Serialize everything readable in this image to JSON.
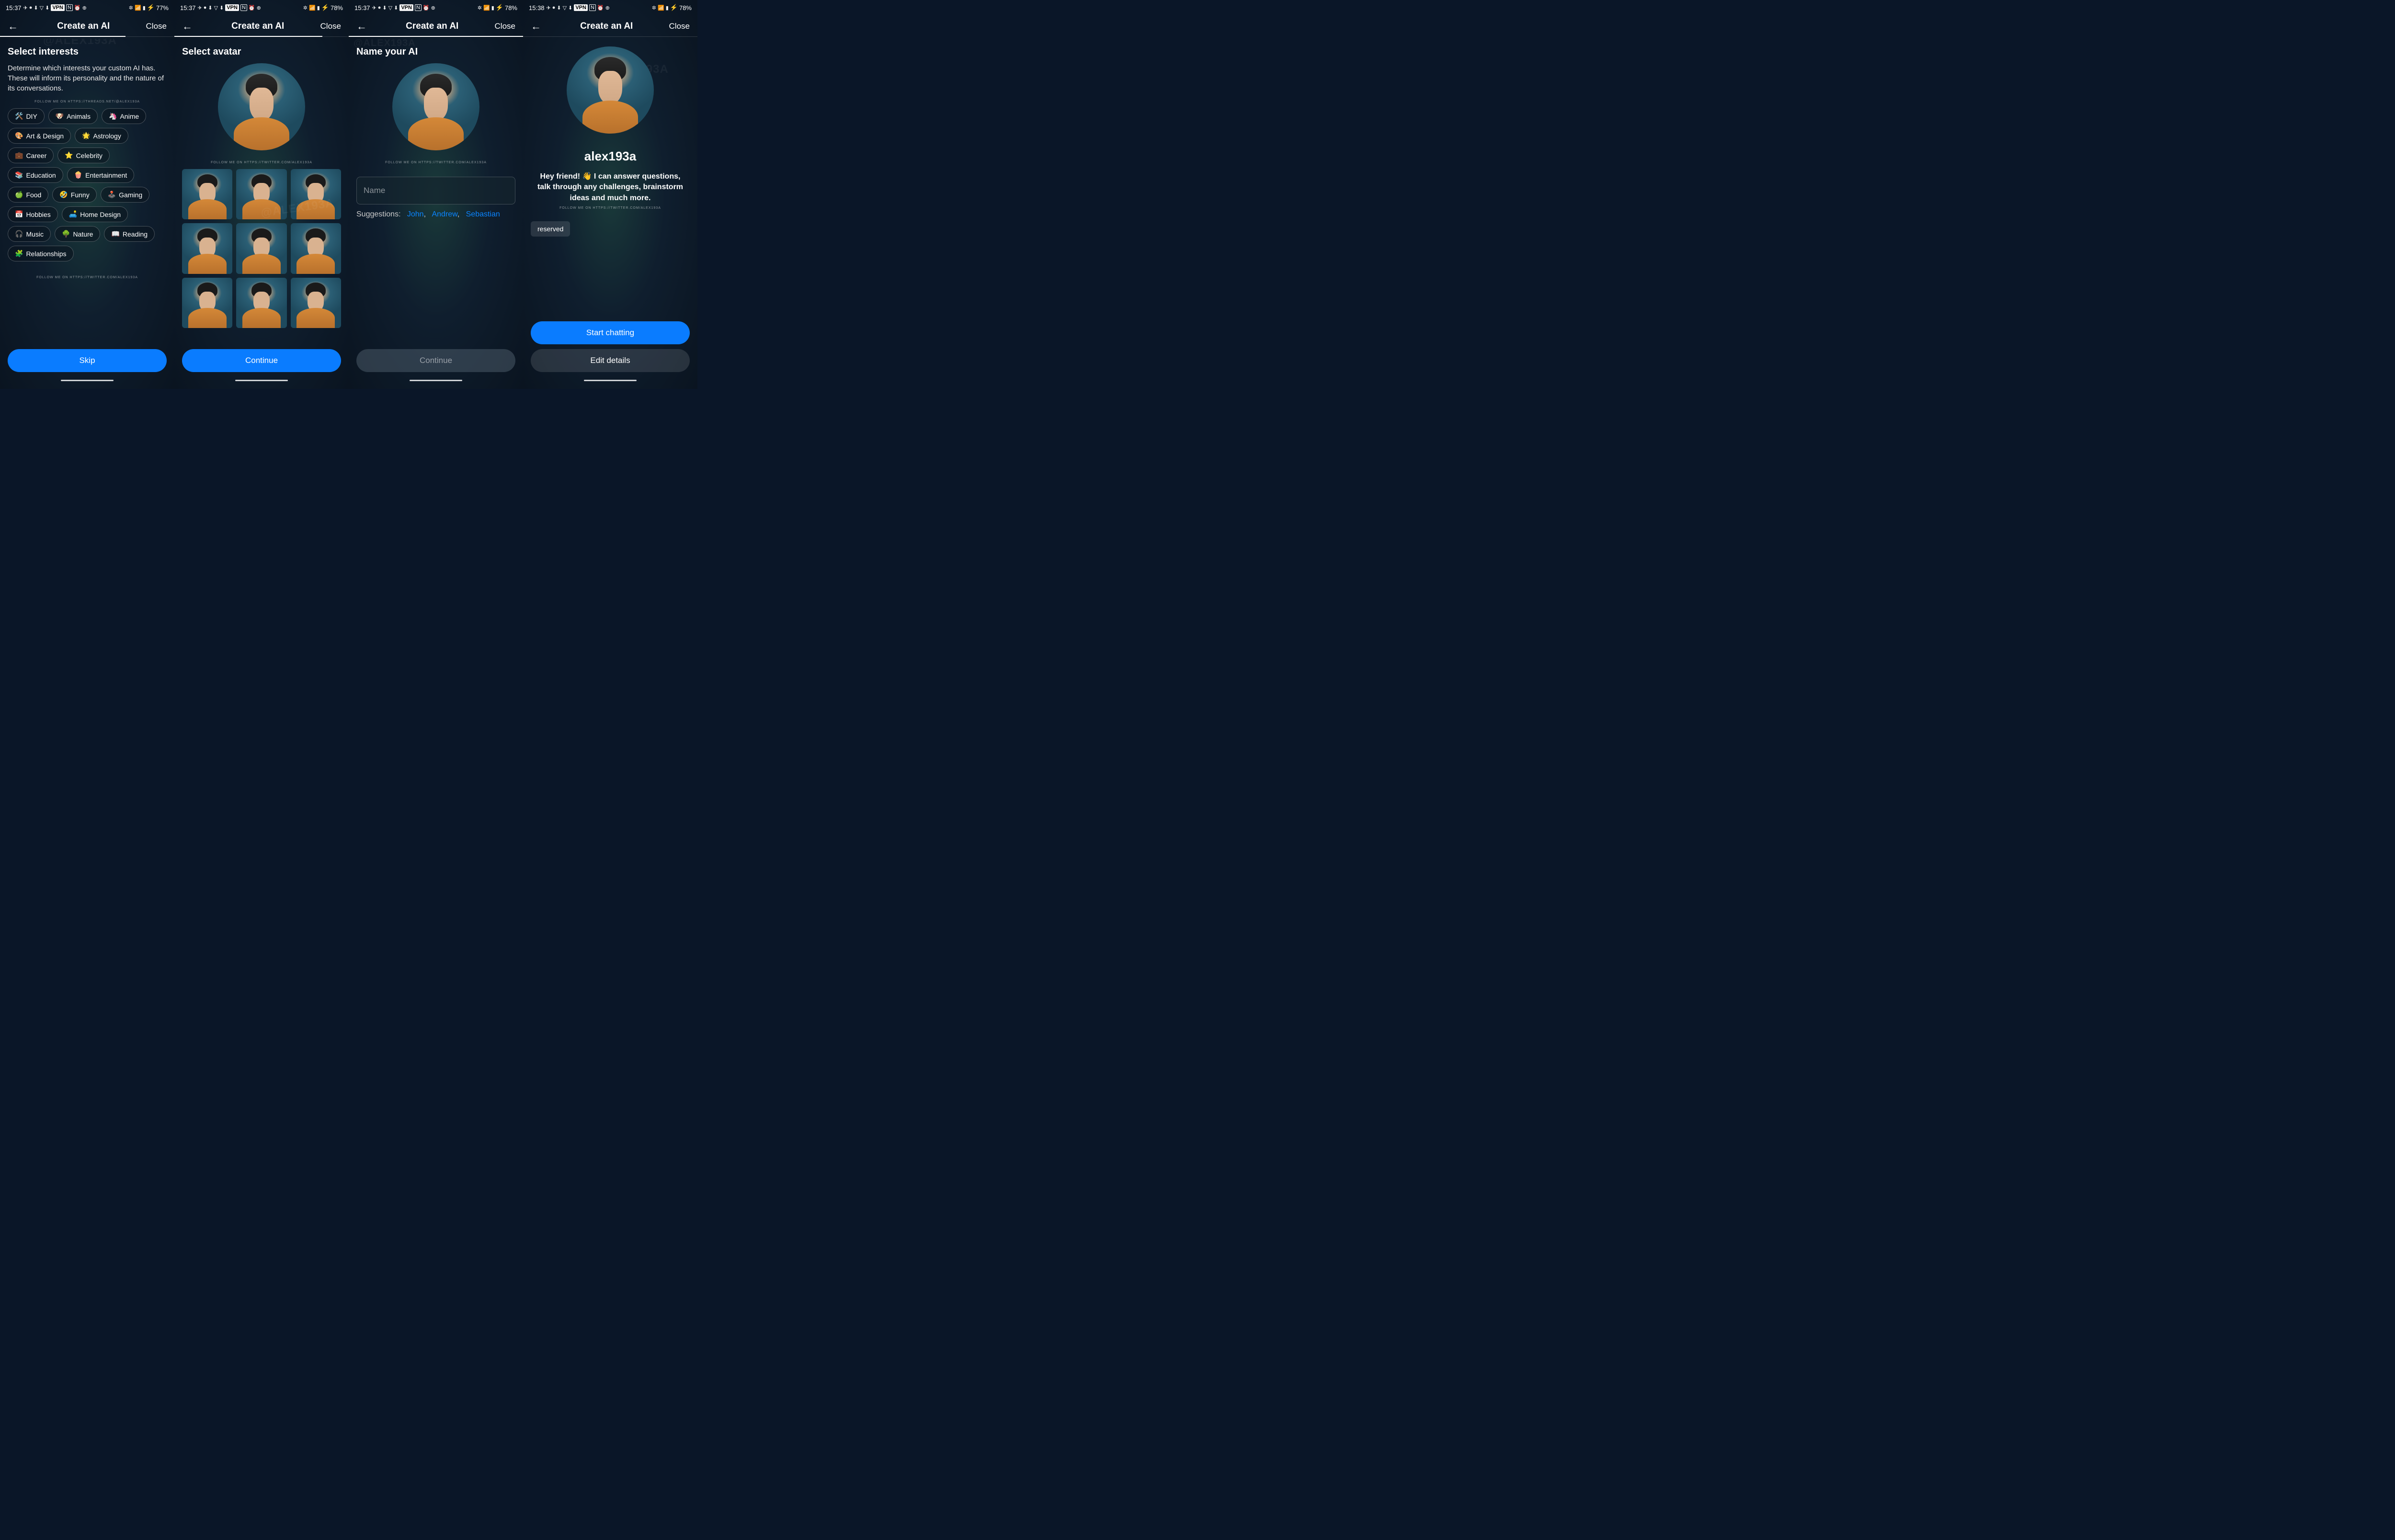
{
  "screens": [
    {
      "statusTime": "15:37",
      "battery": "77%",
      "header": {
        "title": "Create an AI",
        "close": "Close"
      },
      "sectionTitle": "Select interests",
      "sectionDesc": "Determine which interests your custom AI has. These will inform its personality and the nature of its conversations.",
      "followTop": "FOLLOW ME ON HTTPS://THREADS.NET/@ALEX193A",
      "followBottom": "FOLLOW ME ON HTTPS://TWITTER.COM/ALEX193A",
      "interests": [
        {
          "icon": "🛠️",
          "label": "DIY"
        },
        {
          "icon": "🐶",
          "label": "Animals"
        },
        {
          "icon": "🦄",
          "label": "Anime"
        },
        {
          "icon": "🎨",
          "label": "Art & Design"
        },
        {
          "icon": "🌟",
          "label": "Astrology"
        },
        {
          "icon": "💼",
          "label": "Career"
        },
        {
          "icon": "⭐",
          "label": "Celebrity"
        },
        {
          "icon": "📚",
          "label": "Education"
        },
        {
          "icon": "🍿",
          "label": "Entertainment"
        },
        {
          "icon": "🍏",
          "label": "Food"
        },
        {
          "icon": "🤣",
          "label": "Funny"
        },
        {
          "icon": "🕹️",
          "label": "Gaming"
        },
        {
          "icon": "📅",
          "label": "Hobbies"
        },
        {
          "icon": "🛋️",
          "label": "Home Design"
        },
        {
          "icon": "🎧",
          "label": "Music"
        },
        {
          "icon": "🌳",
          "label": "Nature"
        },
        {
          "icon": "📖",
          "label": "Reading"
        },
        {
          "icon": "🧩",
          "label": "Relationships"
        }
      ],
      "primaryBtn": "Skip"
    },
    {
      "statusTime": "15:37",
      "battery": "78%",
      "header": {
        "title": "Create an AI",
        "close": "Close"
      },
      "sectionTitle": "Select avatar",
      "followMid": "FOLLOW ME ON HTTPS://TWITTER.COM/ALEX193A",
      "avatarCount": 9,
      "primaryBtn": "Continue"
    },
    {
      "statusTime": "15:37",
      "battery": "78%",
      "header": {
        "title": "Create an AI",
        "close": "Close"
      },
      "sectionTitle": "Name your AI",
      "followMid": "FOLLOW ME ON HTTPS://TWITTER.COM/ALEX193A",
      "namePlaceholder": "Name",
      "suggestionsLabel": "Suggestions:",
      "suggestions": [
        "John",
        "Andrew",
        "Sebastian"
      ],
      "primaryBtn": "Continue"
    },
    {
      "statusTime": "15:38",
      "battery": "78%",
      "header": {
        "title": "Create an AI",
        "close": "Close"
      },
      "aiName": "alex193a",
      "aiDesc": "Hey friend! 👋 I can answer questions, talk through any challenges, brainstorm ideas and much more.",
      "followMid": "FOLLOW ME ON HTTPS://TWITTER.COM/ALEX193A",
      "reserved": "reserved",
      "primaryBtn": "Start chatting",
      "secondaryBtn": "Edit details"
    }
  ],
  "watermark": "@ALEX193A"
}
